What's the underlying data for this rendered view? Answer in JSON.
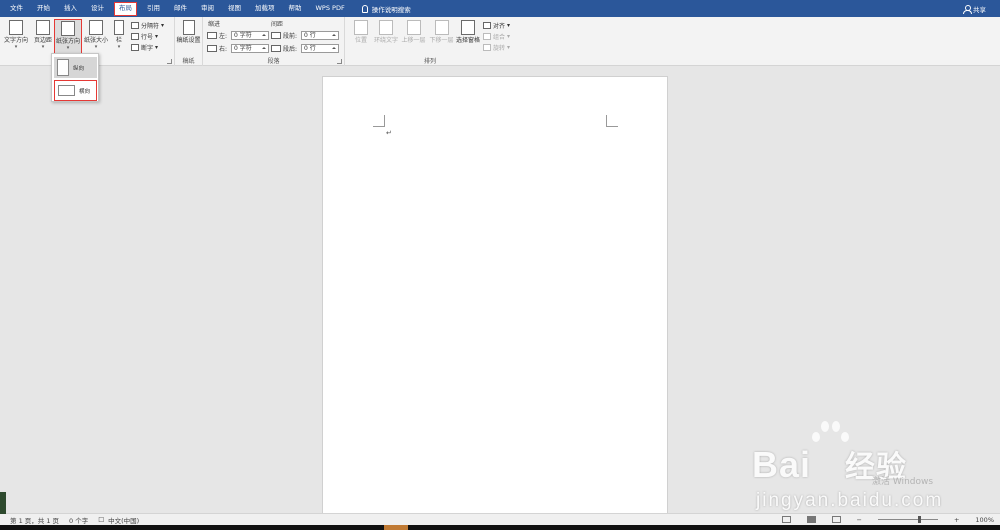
{
  "tabs": [
    "文件",
    "开始",
    "插入",
    "设计",
    "布局",
    "引用",
    "邮件",
    "审阅",
    "视图",
    "加载项",
    "帮助",
    "WPS PDF"
  ],
  "active_tab_index": 4,
  "tell_me": "操作说明搜索",
  "share": "共享",
  "ribbon": {
    "page_setup": {
      "text_direction": "文字方向",
      "margins": "页边距",
      "orientation": "纸张方向",
      "size": "纸张大小",
      "columns": "栏",
      "breaks": "分隔符",
      "line_numbers": "行号",
      "hyphenation": "断字"
    },
    "draft": {
      "label": "稿纸设置",
      "group": "稿纸"
    },
    "paragraph": {
      "indent_header": "缩进",
      "spacing_header": "间距",
      "left_label": "左:",
      "right_label": "右:",
      "left_value": "0 字符",
      "right_value": "0 字符",
      "before_label": "段前:",
      "after_label": "段后:",
      "before_value": "0 行",
      "after_value": "0 行",
      "group": "段落"
    },
    "arrange": {
      "position": "位置",
      "wrap_text": "环绕文字",
      "bring_forward": "上移一层",
      "send_backward": "下移一层",
      "selection_pane": "选择窗格",
      "align": "对齐",
      "group_btn": "组合",
      "rotate": "旋转",
      "group": "排列"
    }
  },
  "orientation_menu": {
    "portrait": "纵向",
    "landscape": "横向"
  },
  "document": {
    "paragraph_mark": "↵"
  },
  "status": {
    "page": "第 1 页，共 1 页",
    "words": "0 个字",
    "language": "中文(中国)",
    "zoom": "100%"
  },
  "watermark": {
    "brand": "Bai",
    "brand_cn": "经验",
    "url": "jingyan.baidu.com",
    "faint": "激活 Windows"
  }
}
